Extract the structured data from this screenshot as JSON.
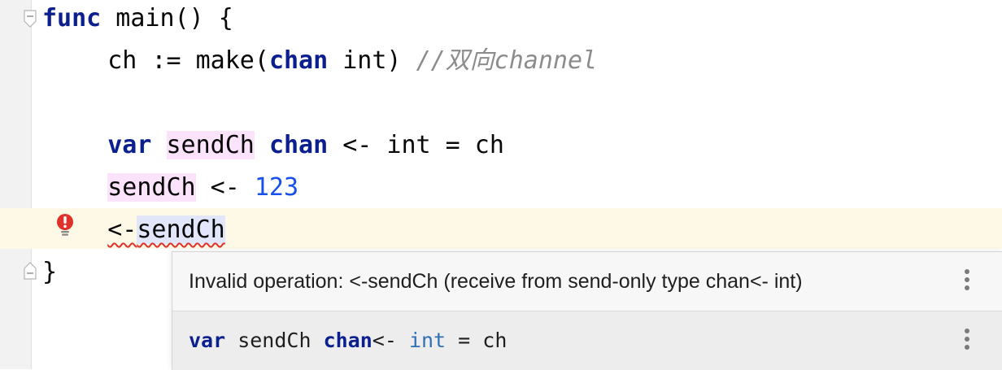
{
  "editor": {
    "lines": {
      "l1": {
        "func_kw": "func",
        "rest": " main() {"
      },
      "l2": {
        "indent": "    ",
        "pre": "ch := make(",
        "chan_kw": "chan",
        "post": " int) ",
        "comment": "//双向channel"
      },
      "l4": {
        "indent": "    ",
        "var_kw": "var",
        "sp1": " ",
        "var_name": "sendCh",
        "sp2": " ",
        "chan_kw": "chan",
        "post": " <- int = ch"
      },
      "l5": {
        "indent": "    ",
        "var_name": "sendCh",
        "op": " <- ",
        "num": "123"
      },
      "l6": {
        "indent": "    ",
        "op": "<-",
        "var_name": "sendCh"
      },
      "l7": {
        "brace": "}"
      }
    }
  },
  "popup": {
    "message": "Invalid operation: <-sendCh (receive from send-only type chan<- int)",
    "decl": {
      "var_kw": "var",
      "name": " sendCh ",
      "chan_kw": "chan",
      "arrow": "<- ",
      "type": "int",
      "rest": " = ch"
    }
  },
  "icons": {
    "error": "error-bulb-icon",
    "fold": "fold-marker-icon",
    "more": "more-vertical-icon"
  },
  "colors": {
    "keyword": "#0b1f8f",
    "number": "#1750eb",
    "comment": "#8c8c8c",
    "error": "#e0312b",
    "var_highlight": "#fbe3fb",
    "error_line": "#fdf9e6"
  }
}
